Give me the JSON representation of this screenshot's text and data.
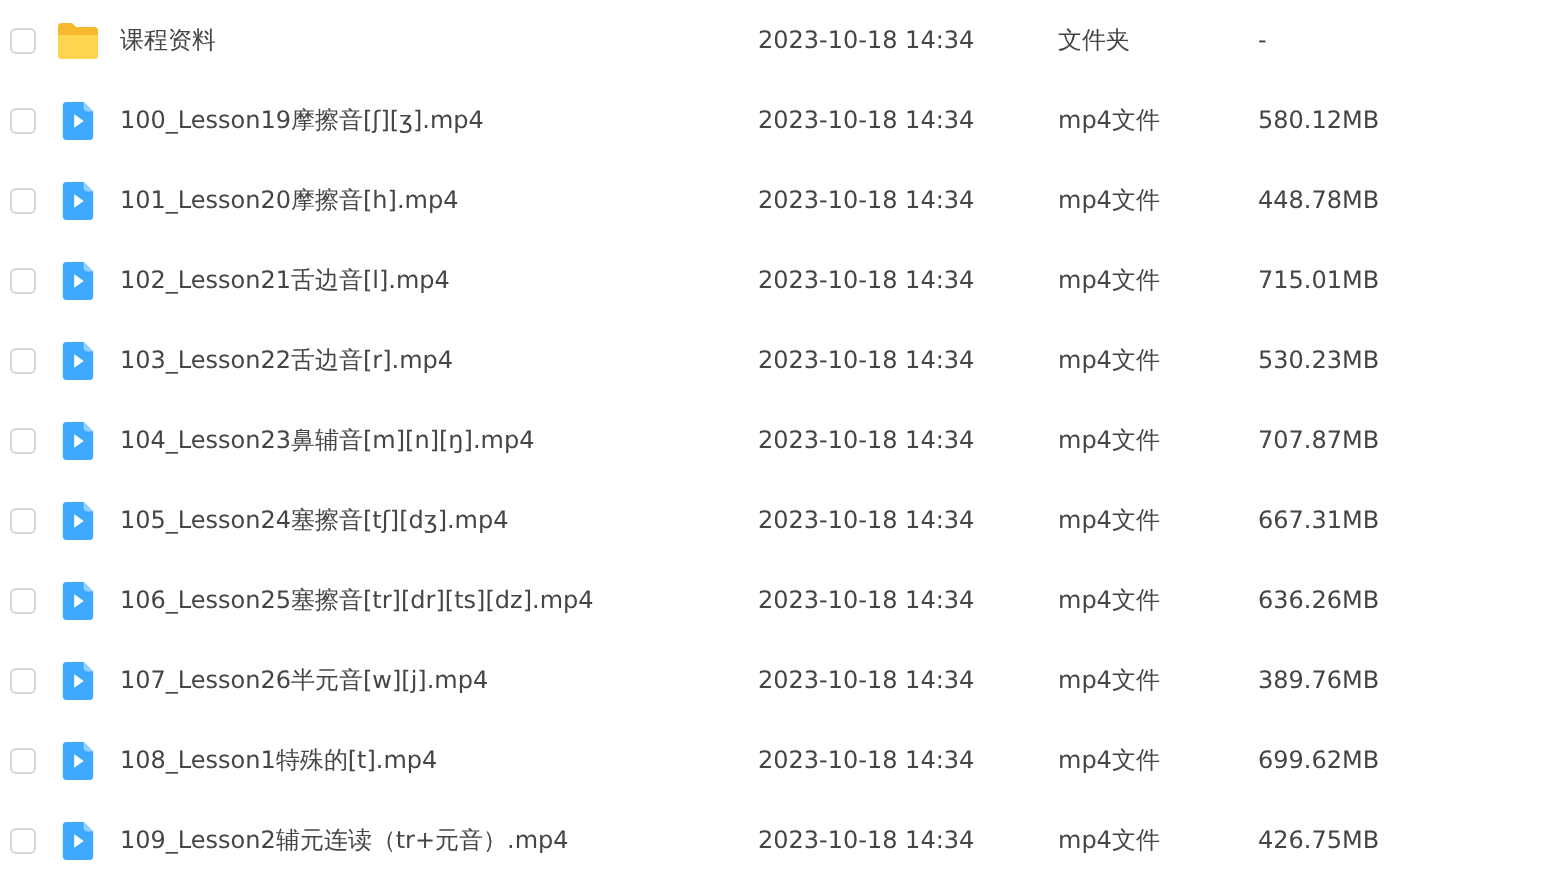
{
  "files": [
    {
      "kind": "folder",
      "selected": false,
      "name": "课程资料",
      "modified": "2023-10-18 14:34",
      "type": "文件夹",
      "size": "-"
    },
    {
      "kind": "video",
      "selected": false,
      "name": "100_Lesson19摩擦音[ʃ][ʒ].mp4",
      "modified": "2023-10-18 14:34",
      "type": "mp4文件",
      "size": "580.12MB"
    },
    {
      "kind": "video",
      "selected": false,
      "name": "101_Lesson20摩擦音[h].mp4",
      "modified": "2023-10-18 14:34",
      "type": "mp4文件",
      "size": "448.78MB"
    },
    {
      "kind": "video",
      "selected": false,
      "name": "102_Lesson21舌边音[l].mp4",
      "modified": "2023-10-18 14:34",
      "type": "mp4文件",
      "size": "715.01MB"
    },
    {
      "kind": "video",
      "selected": false,
      "name": "103_Lesson22舌边音[r].mp4",
      "modified": "2023-10-18 14:34",
      "type": "mp4文件",
      "size": "530.23MB"
    },
    {
      "kind": "video",
      "selected": false,
      "name": "104_Lesson23鼻辅音[m][n][ŋ].mp4",
      "modified": "2023-10-18 14:34",
      "type": "mp4文件",
      "size": "707.87MB"
    },
    {
      "kind": "video",
      "selected": false,
      "name": "105_Lesson24塞擦音[tʃ][dʒ].mp4",
      "modified": "2023-10-18 14:34",
      "type": "mp4文件",
      "size": "667.31MB"
    },
    {
      "kind": "video",
      "selected": false,
      "name": "106_Lesson25塞擦音[tr][dr][ts][dz].mp4",
      "modified": "2023-10-18 14:34",
      "type": "mp4文件",
      "size": "636.26MB"
    },
    {
      "kind": "video",
      "selected": false,
      "name": "107_Lesson26半元音[w][j].mp4",
      "modified": "2023-10-18 14:34",
      "type": "mp4文件",
      "size": "389.76MB"
    },
    {
      "kind": "video",
      "selected": false,
      "name": "108_Lesson1特殊的[t].mp4",
      "modified": "2023-10-18 14:34",
      "type": "mp4文件",
      "size": "699.62MB"
    },
    {
      "kind": "video",
      "selected": false,
      "name": "109_Lesson2辅元连读（tr+元音）.mp4",
      "modified": "2023-10-18 14:34",
      "type": "mp4文件",
      "size": "426.75MB"
    }
  ]
}
